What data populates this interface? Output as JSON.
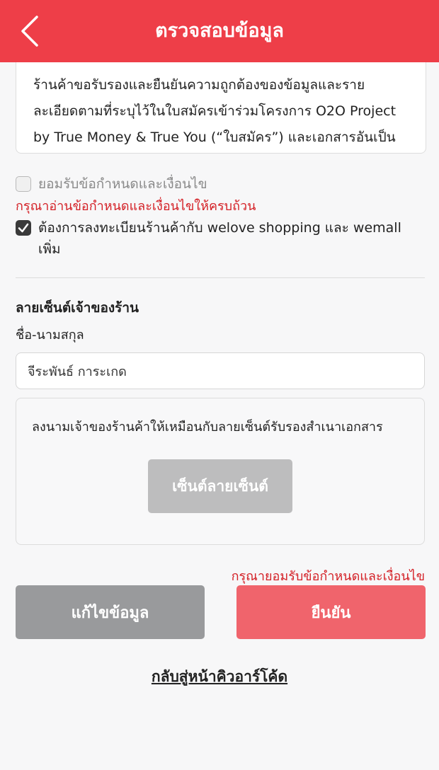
{
  "header": {
    "title": "ตรวจสอบข้อมูล",
    "background": "#ee3e48"
  },
  "terms": {
    "text": "ร้านค้าขอรับรองและยืนยันความถูกต้องของข้อมูลและรายละเอียดตามที่ระบุไว้ในใบสมัครเข้าร่วมโครงการ O2O Project by True Money & True You (“ใบสมัคร”) และเอกสารอันเป็นส่วนหนึ่งหรือประกอบใบสมัคร ในกรณีที่ทรูมันนี่"
  },
  "accept_terms": {
    "label": "ยอมรับข้อกำหนดและเงื่อนไข",
    "checked": false,
    "error": "กรุณาอ่านข้อกำหนดและเงื่อนไขให้ครบถ้วน"
  },
  "register_option": {
    "label": "ต้องการลงทะเบียนร้านค้ากับ welove shopping และ wemall เพิ่ม",
    "checked": true
  },
  "signature": {
    "section_title": "ลายเซ็นต์เจ้าของร้าน",
    "name_label": "ชื่อ-นามสกุล",
    "name_value": "จีระพันธ์ การะเกด",
    "description": "ลงนามเจ้าของร้านค้าให้เหมือนกับลายเซ็นต์รับรองสำเนาเอกสาร",
    "sign_button": "เซ็นต์ลายเซ็นต์"
  },
  "actions": {
    "error": "กรุณายอมรับข้อกำหนดและเงื่อนไข",
    "edit_button": "แก้ไขข้อมูล",
    "confirm_button": "ยืนยัน",
    "back_link": "กลับสู่หน้าคิวอาร์โค้ด"
  },
  "colors": {
    "accent": "#ee3e48",
    "error": "#d42026",
    "confirm": "#f0646c",
    "edit": "#999a9c"
  },
  "icons": {
    "back": "chevron-left-icon",
    "check": "checkmark-icon"
  }
}
